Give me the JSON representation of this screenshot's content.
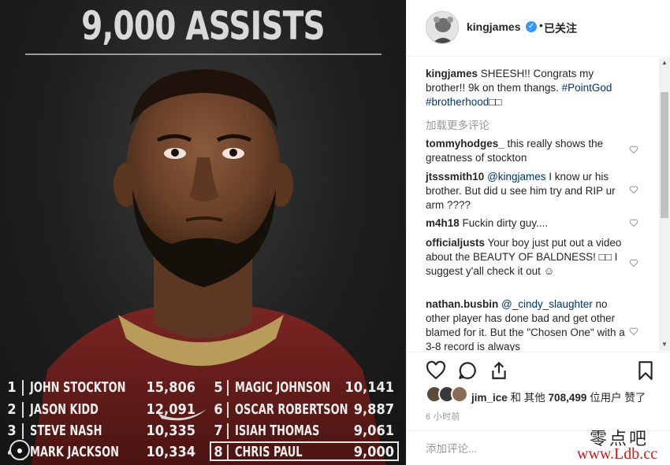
{
  "image": {
    "headline": "9,000 ASSISTS",
    "leaderboard": [
      {
        "rank": "1",
        "name": "JOHN STOCKTON",
        "value": "15,806"
      },
      {
        "rank": "2",
        "name": "JASON KIDD",
        "value": "12,091"
      },
      {
        "rank": "3",
        "name": "STEVE NASH",
        "value": "10,335"
      },
      {
        "rank": "4",
        "name": "MARK JACKSON",
        "value": "10,334"
      },
      {
        "rank": "5",
        "name": "MAGIC JOHNSON",
        "value": "10,141"
      },
      {
        "rank": "6",
        "name": "OSCAR ROBERTSON",
        "value": "9,887"
      },
      {
        "rank": "7",
        "name": "ISIAH THOMAS",
        "value": "9,061"
      },
      {
        "rank": "8",
        "name": "CHRIS PAUL",
        "value": "9,000"
      }
    ]
  },
  "header": {
    "username": "kingjames",
    "follow_status": "已关注",
    "separator": "•"
  },
  "caption": {
    "user": "kingjames",
    "text": " SHEESH!! Congrats my brother!! 9k on them thangs. ",
    "hashtag1": "#PointGod",
    "hashtag2": "#brotherhood",
    "tail": "□□"
  },
  "load_more": "加载更多评论",
  "comments": [
    {
      "user": "tommyhodges_",
      "mention": "",
      "text": " this really shows the greatness of stockton"
    },
    {
      "user": "jtsssmith10",
      "mention": "@kingjames",
      "text": " I know ur his brother. But did u see him try and RIP ur arm ????"
    },
    {
      "user": "m4h18",
      "mention": "",
      "text": " Fuckin dirty guy...."
    },
    {
      "user": "officialjusts",
      "mention": "",
      "text": " Your boy just put out a video about the BEAUTY OF BALDNESS! □□ I suggest y'all check it out ☺"
    },
    {
      "user": "nathan.busbin",
      "mention": "@_cindy_slaughter",
      "text": " no other player has done bad and get other blamed for it. But the \"Chosen One\" with a 3-8 record is always"
    }
  ],
  "likes": {
    "user": "jim_ice",
    "middle": " 和 其他 ",
    "count": "708,499",
    "suffix": " 位用户 赞了"
  },
  "timestamp": "6 小时前",
  "add_comment_placeholder": "添加评论...",
  "watermark": {
    "cn": "零点吧",
    "url": "www.Ldb.cc"
  },
  "icons": {
    "heart": "heart-icon",
    "comment": "comment-icon",
    "share": "share-icon",
    "bookmark": "bookmark-icon",
    "verified": "verified-badge-icon"
  },
  "colors": {
    "link": "#003569",
    "verified": "#3897f0",
    "muted": "#999999",
    "watermark_url": "#cc1a1a"
  }
}
